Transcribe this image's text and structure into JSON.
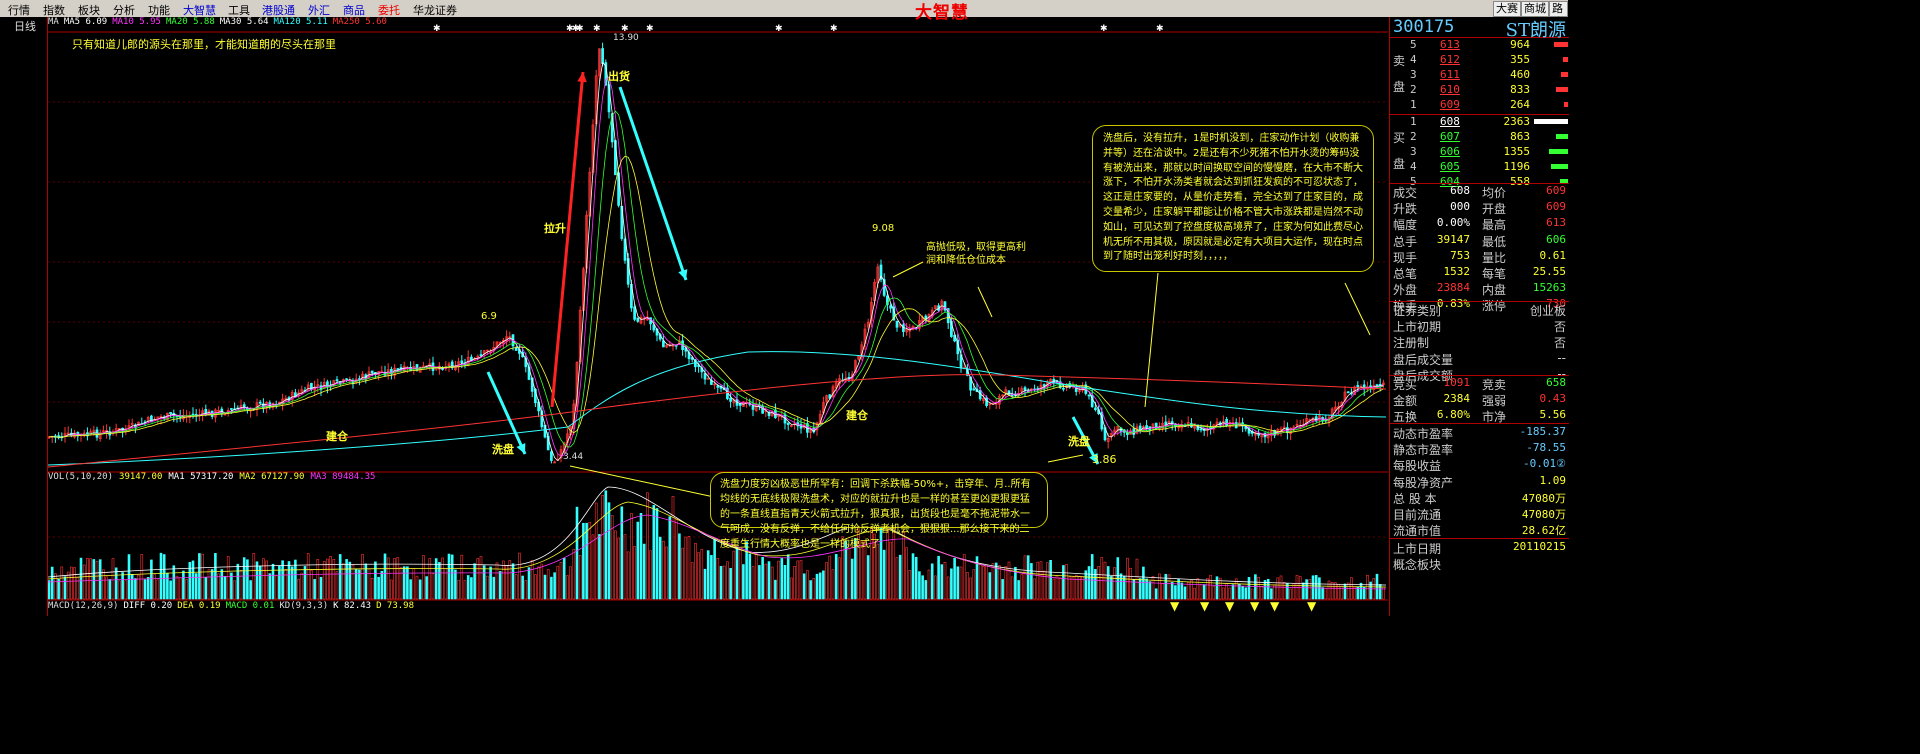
{
  "menu": {
    "items": [
      "行情",
      "指数",
      "板块",
      "分析",
      "功能",
      "大智慧",
      "工具",
      "港股通",
      "外汇",
      "商品",
      "委托",
      "华龙证券"
    ],
    "brand": "大智慧",
    "right_buttons": [
      "大赛",
      "商城",
      "路演"
    ]
  },
  "period_label": "日线",
  "ma_legend": [
    {
      "text": "MA",
      "color": "#dddddd"
    },
    {
      "text": "MA5 6.09",
      "color": "#ffffff"
    },
    {
      "text": "MA10 5.95",
      "color": "#ff33ff"
    },
    {
      "text": "MA20 5.88",
      "color": "#33ff33"
    },
    {
      "text": "MA30 5.64",
      "color": "#ffffff"
    },
    {
      "text": "MA120 5.11",
      "color": "#33ffff"
    },
    {
      "text": "MA250 5.60",
      "color": "#ff3333"
    }
  ],
  "vol_legend": [
    {
      "text": "VOL(5,10,20)",
      "color": "#dddddd"
    },
    {
      "text": "39147.00",
      "color": "#ffff33"
    },
    {
      "text": "MA1 57317.20",
      "color": "#ffffff"
    },
    {
      "text": "MA2 67127.90",
      "color": "#ffff33"
    },
    {
      "text": "MA3 89484.35",
      "color": "#ff33ff"
    }
  ],
  "macd_legend": [
    {
      "text": "MACD(12,26,9)",
      "color": "#dddddd"
    },
    {
      "text": "DIFF 0.20",
      "color": "#ffffff"
    },
    {
      "text": "DEA 0.19",
      "color": "#ffff33"
    },
    {
      "text": "MACD 0.01",
      "color": "#33ff33"
    },
    {
      "text": "KD(9,3,3)",
      "color": "#dddddd"
    },
    {
      "text": "K 82.43",
      "color": "#ffffff"
    },
    {
      "text": "D 73.98",
      "color": "#ffff33"
    }
  ],
  "annotations": {
    "top_note": "只有知道儿郎的源头在那里，才能知道朗的尽头在那里",
    "high_note": "高抛低吸，取得更高利润和降低仓位成本",
    "box_right": "洗盘后，没有拉升，1是时机没到，庄家动作计划（收购兼并等）还在洽谈中。2是还有不少死猪不怕开水烫的筹码没有被洗出来，那就以时间换取空间的慢慢磨，在大市不断大涨下，不怕开水汤类者就会达到抓狂发疯的不可忍状态了，这正是庄家要的，从量价走势看，完全达到了庄家目的，成交量希少，庄家躺平都能让价格不管大市涨跌都是岿然不动如山，可见达到了控盘度极高境界了，庄家为何如此费尽心机无所不用其极，原因就是必定有大项目大运作，现在时点到了随时出笼利好时刻，，，，，",
    "box_bottom": "洗盘力度穷凶极恶世所罕有：回调下杀跌幅-50%+，击穿年、月..所有均线的无底线极限洗盘术，对应的就拉升也是一样的甚至更凶更狠更猛的一条直线直指青天火箭式拉升，狠真狠，出货段也是毫不拖泥带水一气呵成，没有反弹，不给任何抢反弹者机会，狠狠狠...那么接下来的二度重生行情大概率也是一样的模式了",
    "labels": [
      "拉升",
      "出货",
      "洗盘",
      "建仓",
      "建仓",
      "洗盘"
    ],
    "prices": [
      "13.90",
      "9.08",
      "6.9",
      "3.44",
      "3.86"
    ]
  },
  "quote": {
    "code": "300175",
    "name": "ST朗源",
    "sell_label": "卖盘",
    "buy_label": "买盘",
    "sell": [
      {
        "level": "5",
        "price": "613",
        "vol": "964",
        "bar": 0.4
      },
      {
        "level": "4",
        "price": "612",
        "vol": "355",
        "bar": 0.15
      },
      {
        "level": "3",
        "price": "611",
        "vol": "460",
        "bar": 0.2
      },
      {
        "level": "2",
        "price": "610",
        "vol": "833",
        "bar": 0.35
      },
      {
        "level": "1",
        "price": "609",
        "vol": "264",
        "bar": 0.12
      }
    ],
    "buy": [
      {
        "level": "1",
        "price": "608",
        "vol": "2363",
        "bar": 1.0
      },
      {
        "level": "2",
        "price": "607",
        "vol": "863",
        "bar": 0.36
      },
      {
        "level": "3",
        "price": "606",
        "vol": "1355",
        "bar": 0.57
      },
      {
        "level": "4",
        "price": "605",
        "vol": "1196",
        "bar": 0.5
      },
      {
        "level": "5",
        "price": "604",
        "vol": "558",
        "bar": 0.24
      }
    ],
    "stats1": [
      {
        "k": "成交",
        "v": "608",
        "vc": "#ffffff",
        "k2": "均价",
        "v2": "609",
        "v2c": "#ff3333"
      },
      {
        "k": "升跌",
        "v": "000",
        "vc": "#ffffff",
        "k2": "开盘",
        "v2": "609",
        "v2c": "#ff3333"
      },
      {
        "k": "幅度",
        "v": "0.00%",
        "vc": "#ffffff",
        "k2": "最高",
        "v2": "613",
        "v2c": "#ff3333"
      },
      {
        "k": "总手",
        "v": "39147",
        "vc": "#ffff33",
        "k2": "最低",
        "v2": "606",
        "v2c": "#33ff33"
      },
      {
        "k": "现手",
        "v": "753",
        "vc": "#ffff33",
        "k2": "量比",
        "v2": "0.61",
        "v2c": "#ffff33"
      },
      {
        "k": "总笔",
        "v": "1532",
        "vc": "#ffff33",
        "k2": "每笔",
        "v2": "25.55",
        "v2c": "#ffff33"
      },
      {
        "k": "外盘",
        "v": "23884",
        "vc": "#ff3333",
        "k2": "内盘",
        "v2": "15263",
        "v2c": "#33ff33"
      },
      {
        "k": "换手",
        "v": "0.83%",
        "vc": "#ffff33",
        "k2": "涨停",
        "v2": "730",
        "v2c": "#ff3333"
      }
    ],
    "stats2": [
      {
        "k": "证券类别",
        "v": "创业板"
      },
      {
        "k": "上市初期",
        "v": "否"
      },
      {
        "k": "注册制",
        "v": "否"
      },
      {
        "k": "盘后成交量",
        "v": "--"
      },
      {
        "k": "盘后成交额",
        "v": "--"
      }
    ],
    "stats3": [
      {
        "k": "竞买",
        "v": "1091",
        "vc": "#ff3333",
        "k2": "竞卖",
        "v2": "658",
        "v2c": "#33ff33"
      },
      {
        "k": "金额",
        "v": "2384",
        "vc": "#ffff33",
        "k2": "强弱",
        "v2": "0.43",
        "v2c": "#ff3333"
      },
      {
        "k": "五换",
        "v": "6.80%",
        "vc": "#ffff33",
        "k2": "市净",
        "v2": "5.56",
        "v2c": "#ffff33"
      }
    ],
    "stats4": [
      {
        "k": "动态市盈率",
        "v": "-185.37",
        "vc": "#66ccff"
      },
      {
        "k": "静态市盈率",
        "v": "-78.55",
        "vc": "#66ccff"
      },
      {
        "k": "每股收益",
        "v": "-0.01②",
        "vc": "#66ccff"
      },
      {
        "k": "每股净资产",
        "v": "1.09",
        "vc": "#ffff33"
      },
      {
        "k": "总 股 本",
        "v": "47080万",
        "vc": "#ffff33"
      },
      {
        "k": "目前流通",
        "v": "47080万",
        "vc": "#ffff33"
      },
      {
        "k": "流通市值",
        "v": "28.62亿",
        "vc": "#ffff33"
      }
    ],
    "stats5": [
      {
        "k": "上市日期",
        "v": "20110215",
        "vc": "#ffff33"
      },
      {
        "k": "概念板块",
        "v": "",
        "vc": "#ffff33"
      }
    ]
  },
  "colors": {
    "up": "#ff3333",
    "down": "#33ffff",
    "accent": "#ffff33",
    "border": "#b00000"
  }
}
